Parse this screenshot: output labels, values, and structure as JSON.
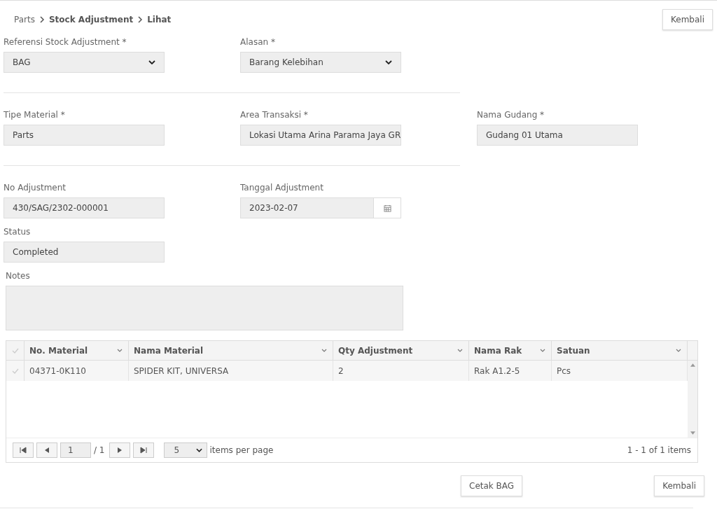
{
  "breadcrumb": [
    {
      "label": "Parts",
      "bold": false
    },
    {
      "label": "Stock Adjustment",
      "bold": true
    },
    {
      "label": "Lihat",
      "bold": true
    }
  ],
  "top_button": "Kembali",
  "sections": [
    [
      [
        {
          "label": "Referensi Stock Adjustment *",
          "value": "BAG",
          "kind": "select"
        },
        {
          "label": "Alasan *",
          "value": "Barang Kelebihan",
          "kind": "select"
        }
      ]
    ],
    [
      [
        {
          "label": "Tipe Material *",
          "value": "Parts",
          "kind": "text"
        },
        {
          "label": "Area Transaksi *",
          "value": "Lokasi Utama Arina Parama Jaya GR",
          "kind": "text"
        },
        {
          "label": "Nama Gudang *",
          "value": "Gudang 01 Utama",
          "kind": "text"
        }
      ]
    ],
    [
      [
        {
          "label": "No Adjustment",
          "value": "430/SAG/2302-000001",
          "kind": "text"
        },
        {
          "label": "Tanggal Adjustment",
          "value": "2023-02-07",
          "kind": "date"
        }
      ],
      [
        {
          "label": "Status",
          "value": "Completed",
          "kind": "text"
        }
      ]
    ]
  ],
  "notes": {
    "label": "Notes"
  },
  "table": {
    "columns": [
      "No. Material",
      "Nama Material",
      "Qty Adjustment",
      "Nama Rak",
      "Satuan"
    ],
    "rows": [
      [
        "04371-0K110",
        "SPIDER KIT, UNIVERSA",
        "2",
        "Rak A1.2-5",
        "Pcs"
      ]
    ]
  },
  "pager": {
    "page": "1",
    "of": "/ 1",
    "page_size": "5",
    "per_page_label": "items per page",
    "summary": "1 - 1 of 1 items"
  },
  "buttons": [
    "Cetak BAG",
    "Kembali"
  ]
}
